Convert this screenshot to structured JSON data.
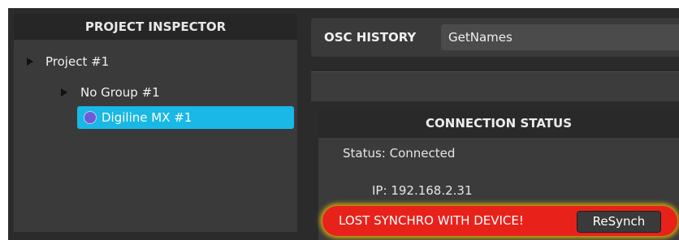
{
  "inspector": {
    "header": "PROJECT INSPECTOR",
    "tree": [
      {
        "label": "Project #1"
      },
      {
        "label": "No Group #1"
      },
      {
        "label": "Digiline MX #1",
        "selected": true
      }
    ]
  },
  "osc": {
    "label": "OSC HISTORY",
    "value": "GetNames"
  },
  "connection": {
    "header": "CONNECTION STATUS",
    "status_label": "Status:",
    "status_value": "Connected",
    "ip_label": "IP:",
    "ip_value": "192.168.2.31",
    "alert_text": "LOST SYNCHRO WITH DEVICE!",
    "resync_label": "ReSynch"
  },
  "colors": {
    "selection": "#19b8e6",
    "alert": "#e8221b",
    "glow": "#ffc800"
  },
  "icons": [
    "expand-triangle-icon",
    "device-circle-icon"
  ]
}
